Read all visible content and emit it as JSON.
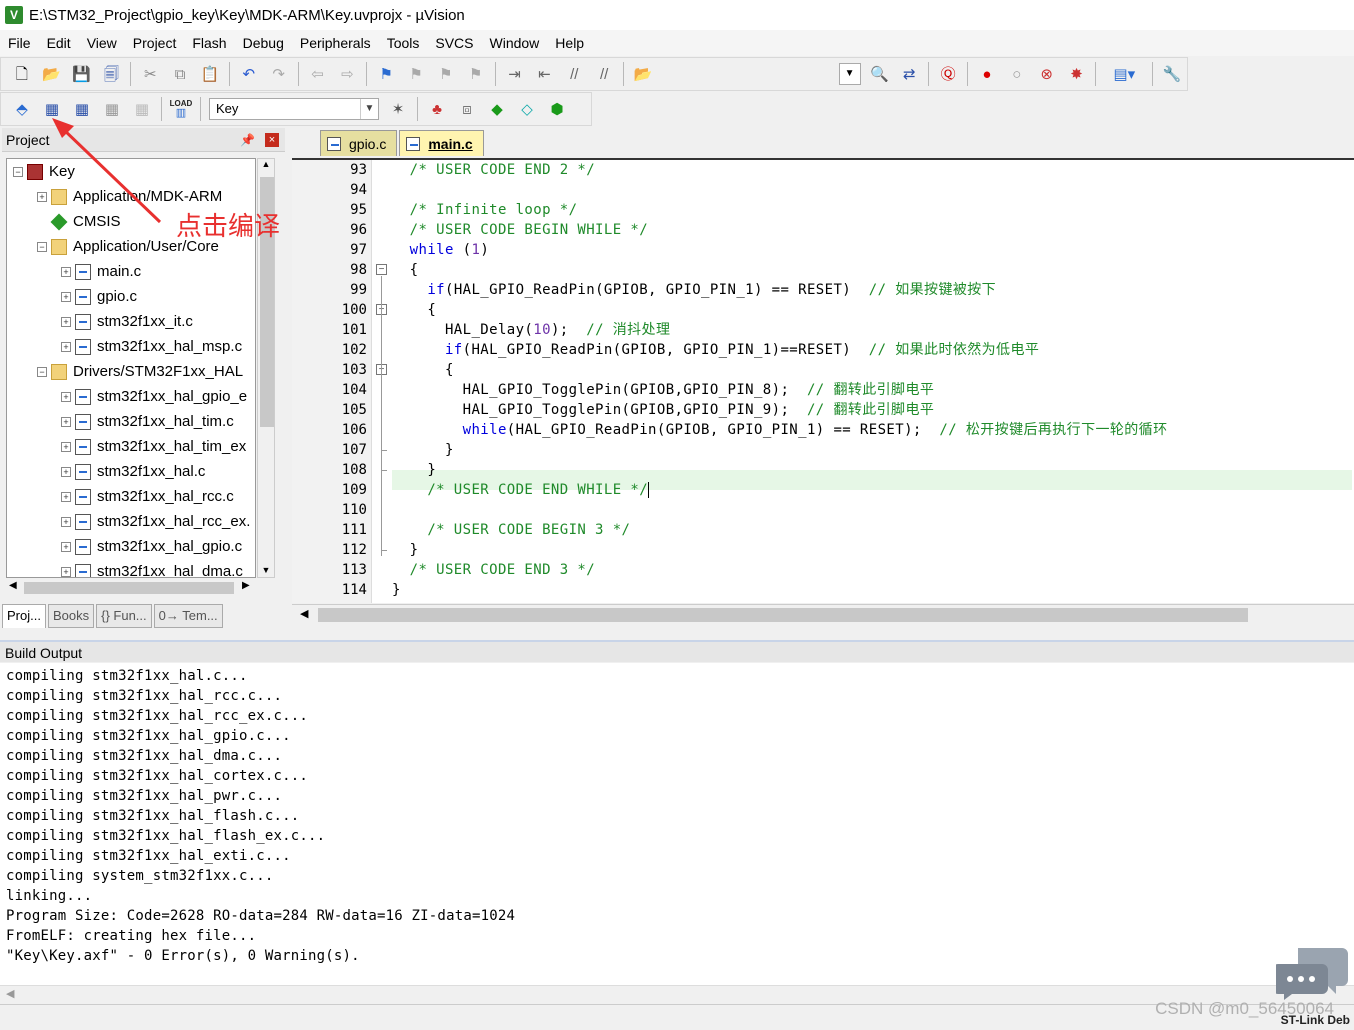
{
  "window": {
    "title": "E:\\STM32_Project\\gpio_key\\Key\\MDK-ARM\\Key.uvprojx - µVision"
  },
  "menu": [
    "File",
    "Edit",
    "View",
    "Project",
    "Flash",
    "Debug",
    "Peripherals",
    "Tools",
    "SVCS",
    "Window",
    "Help"
  ],
  "toolbar2": {
    "load_label": "LOAD",
    "target": "Key"
  },
  "project_panel": {
    "title": "Project",
    "tree": [
      {
        "label": "Key",
        "level": 0,
        "icon": "target-icon",
        "expander": "−"
      },
      {
        "label": "Application/MDK-ARM",
        "level": 1,
        "icon": "folder-icon",
        "expander": "+"
      },
      {
        "label": "CMSIS",
        "level": 1,
        "icon": "cmsis-icon",
        "expander": ""
      },
      {
        "label": "Application/User/Core",
        "level": 1,
        "icon": "folder-icon",
        "expander": "−"
      },
      {
        "label": "main.c",
        "level": 2,
        "icon": "file-icon",
        "expander": "+"
      },
      {
        "label": "gpio.c",
        "level": 2,
        "icon": "file-icon",
        "expander": "+"
      },
      {
        "label": "stm32f1xx_it.c",
        "level": 2,
        "icon": "file-icon",
        "expander": "+"
      },
      {
        "label": "stm32f1xx_hal_msp.c",
        "level": 2,
        "icon": "file-icon",
        "expander": "+"
      },
      {
        "label": "Drivers/STM32F1xx_HAL",
        "level": 1,
        "icon": "folder-icon",
        "expander": "−"
      },
      {
        "label": "stm32f1xx_hal_gpio_e",
        "level": 2,
        "icon": "file-icon",
        "expander": "+"
      },
      {
        "label": "stm32f1xx_hal_tim.c",
        "level": 2,
        "icon": "file-icon",
        "expander": "+"
      },
      {
        "label": "stm32f1xx_hal_tim_ex",
        "level": 2,
        "icon": "file-icon",
        "expander": "+"
      },
      {
        "label": "stm32f1xx_hal.c",
        "level": 2,
        "icon": "file-icon",
        "expander": "+"
      },
      {
        "label": "stm32f1xx_hal_rcc.c",
        "level": 2,
        "icon": "file-icon",
        "expander": "+"
      },
      {
        "label": "stm32f1xx_hal_rcc_ex.",
        "level": 2,
        "icon": "file-icon",
        "expander": "+"
      },
      {
        "label": "stm32f1xx_hal_gpio.c",
        "level": 2,
        "icon": "file-icon",
        "expander": "+"
      },
      {
        "label": "stm32f1xx_hal_dma.c",
        "level": 2,
        "icon": "file-icon",
        "expander": "+"
      }
    ],
    "bottom_tabs": [
      "Proj...",
      "Books",
      "{} Fun...",
      "0→ Tem..."
    ]
  },
  "annotation": "点击编译",
  "editor": {
    "tabs": [
      {
        "label": "gpio.c",
        "active": false
      },
      {
        "label": "main.c",
        "active": true
      }
    ],
    "lines": [
      {
        "n": "93",
        "segs": [
          [
            "cm",
            "  /* USER CODE END 2 */"
          ]
        ]
      },
      {
        "n": "94",
        "segs": []
      },
      {
        "n": "95",
        "segs": [
          [
            "cm",
            "  /* Infinite loop */"
          ]
        ]
      },
      {
        "n": "96",
        "segs": [
          [
            "cm",
            "  /* USER CODE BEGIN WHILE */"
          ]
        ]
      },
      {
        "n": "97",
        "segs": [
          [
            "kw",
            "  while"
          ],
          [
            "",
            " ("
          ],
          [
            "nm",
            "1"
          ],
          [
            "",
            ")"
          ]
        ]
      },
      {
        "n": "98",
        "segs": [
          [
            "",
            "  {"
          ]
        ]
      },
      {
        "n": "99",
        "segs": [
          [
            "kw",
            "    if"
          ],
          [
            "",
            "(HAL_GPIO_ReadPin(GPIOB, GPIO_PIN_1) == RESET)  "
          ],
          [
            "cm",
            "// 如果按键被按下"
          ]
        ]
      },
      {
        "n": "100",
        "segs": [
          [
            "",
            "    {"
          ]
        ]
      },
      {
        "n": "101",
        "segs": [
          [
            "",
            "      HAL_Delay("
          ],
          [
            "nm",
            "10"
          ],
          [
            "",
            ");  "
          ],
          [
            "cm",
            "// 消抖处理"
          ]
        ]
      },
      {
        "n": "102",
        "segs": [
          [
            "kw",
            "      if"
          ],
          [
            "",
            "(HAL_GPIO_ReadPin(GPIOB, GPIO_PIN_1)==RESET)  "
          ],
          [
            "cm",
            "// 如果此时依然为低电平"
          ]
        ]
      },
      {
        "n": "103",
        "segs": [
          [
            "",
            "      {"
          ]
        ]
      },
      {
        "n": "104",
        "segs": [
          [
            "",
            "        HAL_GPIO_TogglePin(GPIOB,GPIO_PIN_8);  "
          ],
          [
            "cm",
            "// 翻转此引脚电平"
          ]
        ]
      },
      {
        "n": "105",
        "segs": [
          [
            "",
            "        HAL_GPIO_TogglePin(GPIOB,GPIO_PIN_9);  "
          ],
          [
            "cm",
            "// 翻转此引脚电平"
          ]
        ]
      },
      {
        "n": "106",
        "segs": [
          [
            "kw",
            "        while"
          ],
          [
            "",
            "(HAL_GPIO_ReadPin(GPIOB, GPIO_PIN_1) == RESET);  "
          ],
          [
            "cm",
            "// 松开按键后再执行下一轮的循环"
          ]
        ]
      },
      {
        "n": "107",
        "segs": [
          [
            "",
            "      }"
          ]
        ]
      },
      {
        "n": "108",
        "segs": [
          [
            "",
            "    }"
          ]
        ]
      },
      {
        "n": "109",
        "segs": [
          [
            "cm",
            "    /* USER CODE END WHILE */"
          ]
        ]
      },
      {
        "n": "110",
        "segs": []
      },
      {
        "n": "111",
        "segs": [
          [
            "cm",
            "    /* USER CODE BEGIN 3 */"
          ]
        ]
      },
      {
        "n": "112",
        "segs": [
          [
            "",
            "  }"
          ]
        ]
      },
      {
        "n": "113",
        "segs": [
          [
            "cm",
            "  /* USER CODE END 3 */"
          ]
        ]
      },
      {
        "n": "114",
        "segs": [
          [
            "",
            "}"
          ]
        ]
      }
    ]
  },
  "build_output": {
    "title": "Build Output",
    "lines": [
      "compiling stm32f1xx_hal.c...",
      "compiling stm32f1xx_hal_rcc.c...",
      "compiling stm32f1xx_hal_rcc_ex.c...",
      "compiling stm32f1xx_hal_gpio.c...",
      "compiling stm32f1xx_hal_dma.c...",
      "compiling stm32f1xx_hal_cortex.c...",
      "compiling stm32f1xx_hal_pwr.c...",
      "compiling stm32f1xx_hal_flash.c...",
      "compiling stm32f1xx_hal_flash_ex.c...",
      "compiling stm32f1xx_hal_exti.c...",
      "compiling system_stm32f1xx.c...",
      "linking...",
      "Program Size: Code=2628 RO-data=284 RW-data=16 ZI-data=1024",
      "FromELF: creating hex file...",
      "\"Key\\Key.axf\" - 0 Error(s), 0 Warning(s)."
    ]
  },
  "status": {
    "right": "ST-Link Deb"
  },
  "watermark": "CSDN @m0_56450064",
  "colors": {
    "comment": "#1f8a2a",
    "keyword": "#0000dd",
    "number": "#6d32a8",
    "annotation": "#e8302f",
    "tab_active": "#fff4b0"
  }
}
